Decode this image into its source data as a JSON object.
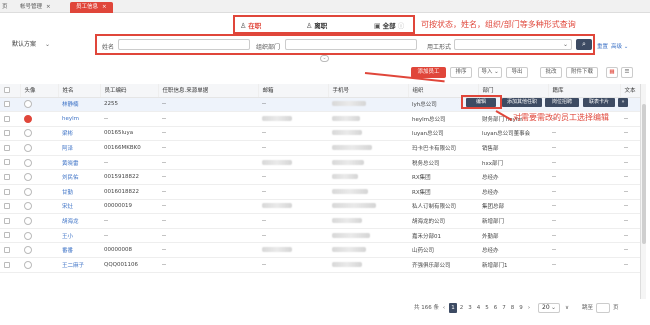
{
  "tabs": {
    "home": "页",
    "account": "帐号管理",
    "employee": "员工信息"
  },
  "status": {
    "active": "在职",
    "resigned": "离职",
    "all": "全部"
  },
  "annotation_top": "可按状态，姓名，组织/部门等多种形式查询",
  "annotation_mid": "对需要需改的员工选择编辑",
  "scheme": "默认方案",
  "filters": {
    "name_label": "姓名",
    "org_label": "组织部门",
    "type_label": "用工形式",
    "reset": "重置",
    "advanced": "高级"
  },
  "toolbar": {
    "add": "添加员工",
    "sort": "排序",
    "import": "导入",
    "export": "导出",
    "batch": "批改",
    "attach": "附件下载"
  },
  "columns": [
    "",
    "头像",
    "姓名",
    "员工编码",
    "任职信息.来源单据",
    "邮箱",
    "手机号",
    "组织",
    "部门",
    "籍库",
    "文本"
  ],
  "row_actions": {
    "edit": "编辑",
    "add_other": "添加其他任职",
    "position": "岗位招聘",
    "card": "联表卡片"
  },
  "rows": [
    {
      "name": "林静楠",
      "code": "2255",
      "info": "--",
      "email": "",
      "phone": "",
      "org": "lyh总公司",
      "dept": "",
      "ji": "",
      "text": "",
      "avatar": "plain",
      "highlight": true
    },
    {
      "name": "heylm",
      "code": "--",
      "info": "--",
      "email": "",
      "phone": "",
      "org": "heylm总公司",
      "dept": "财务部门 heylm",
      "ji": "--",
      "text": "--",
      "avatar": "red",
      "highlight": false
    },
    {
      "name": "梁彬",
      "code": "00165luya",
      "info": "--",
      "email": "",
      "phone": "",
      "org": "luyan总公司",
      "dept": "luyan总公司董事会",
      "ji": "--",
      "text": "--",
      "avatar": "plain",
      "highlight": false
    },
    {
      "name": "阿泽",
      "code": "00166MKBK0",
      "info": "--",
      "email": "",
      "phone": "",
      "org": "玛卡巴卡有限公司",
      "dept": "销售部",
      "ji": "--",
      "text": "--",
      "avatar": "plain",
      "highlight": false
    },
    {
      "name": "黄晓雷",
      "code": "--",
      "info": "--",
      "email": "",
      "phone": "",
      "org": "税务总公司",
      "dept": "hxx部门",
      "ji": "--",
      "text": "--",
      "avatar": "plain",
      "highlight": false
    },
    {
      "name": "刘民佑",
      "code": "0015918822",
      "info": "--",
      "email": "",
      "phone": "",
      "org": "RX集团",
      "dept": "总经办",
      "ji": "--",
      "text": "--",
      "avatar": "plain",
      "highlight": false
    },
    {
      "name": "甘勤",
      "code": "0016018822",
      "info": "--",
      "email": "",
      "phone": "",
      "org": "RX集团",
      "dept": "总经办",
      "ji": "--",
      "text": "--",
      "avatar": "plain",
      "highlight": false
    },
    {
      "name": "宋灶",
      "code": "00000019",
      "info": "--",
      "email": "",
      "phone": "",
      "org": "私人订制有限公司",
      "dept": "集团总部",
      "ji": "--",
      "text": "--",
      "avatar": "plain",
      "highlight": false
    },
    {
      "name": "胡海龙",
      "code": "--",
      "info": "--",
      "email": "",
      "phone": "",
      "org": "胡海龙的公司",
      "dept": "新增部门",
      "ji": "--",
      "text": "--",
      "avatar": "plain",
      "highlight": false
    },
    {
      "name": "王小",
      "code": "--",
      "info": "--",
      "email": "",
      "phone": "",
      "org": "嘉禾分部01",
      "dept": "外勤部",
      "ji": "--",
      "text": "--",
      "avatar": "plain",
      "highlight": false
    },
    {
      "name": "番番",
      "code": "00000008",
      "info": "--",
      "email": "",
      "phone": "",
      "org": "山药公司",
      "dept": "总经办",
      "ji": "--",
      "text": "--",
      "avatar": "plain",
      "highlight": false
    },
    {
      "name": "王二麻子",
      "code": "QQQ001106",
      "info": "--",
      "email": "",
      "phone": "",
      "org": "齐强俱乐部公司",
      "dept": "新增部门1",
      "ji": "--",
      "text": "--",
      "avatar": "plain",
      "highlight": false
    }
  ],
  "pager": {
    "total": "共 166 条",
    "pages": [
      "1",
      "2",
      "3",
      "4",
      "5",
      "6",
      "7",
      "8",
      "9"
    ],
    "size": "20",
    "goto": "跳至",
    "page_suffix": "页"
  }
}
